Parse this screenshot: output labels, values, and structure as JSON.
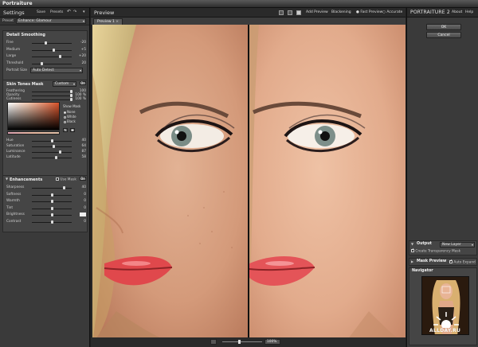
{
  "window": {
    "title": "Portraiture"
  },
  "settings": {
    "title": "Settings",
    "save_label": "Save",
    "presets_label": "Presets",
    "undo_icon": "undo-icon",
    "preset_label": "Preset",
    "preset_value": "Enhance: Glamour",
    "detail_smoothing": {
      "title": "Detail Smoothing",
      "sliders": [
        {
          "label": "Fine",
          "value": "-20",
          "level": 0.35
        },
        {
          "label": "Medium",
          "value": "+5",
          "level": 0.55
        },
        {
          "label": "Large",
          "value": "+20",
          "level": 0.7
        },
        {
          "label": "Threshold",
          "value": "20",
          "level": 0.25
        }
      ],
      "portrait_size_label": "Portrait Size",
      "portrait_size_value": "Auto Detect"
    },
    "skin_tones_mask": {
      "title": "Skin Tones Mask",
      "mode_value": "Custom",
      "toggle": "On",
      "sliders": [
        {
          "label": "Feathering",
          "value": "100",
          "level": 0.98
        },
        {
          "label": "Opacity",
          "value": "100 %",
          "level": 0.98
        },
        {
          "label": "Cutiness",
          "value": "100 %",
          "level": 0.98
        }
      ],
      "show_mask_label": "Show Mask",
      "show_mask_options": [
        "None",
        "White",
        "Black"
      ],
      "show_mask_selected": "None",
      "sliders2": [
        {
          "label": "Hue",
          "value": "40",
          "level": 0.5
        },
        {
          "label": "Saturation",
          "value": "64",
          "level": 0.55
        },
        {
          "label": "Luminance",
          "value": "87",
          "level": 0.7
        },
        {
          "label": "Latitude",
          "value": "58",
          "level": 0.6
        }
      ]
    },
    "enhancements": {
      "title": "Enhancements",
      "use_mask_label": "Use Mask",
      "toggle": "On",
      "sliders": [
        {
          "label": "Sharpness",
          "value": "40",
          "level": 0.8
        },
        {
          "label": "Softness",
          "value": "0",
          "level": 0.5
        },
        {
          "label": "Warmth",
          "value": "0",
          "level": 0.5
        },
        {
          "label": "Tint",
          "value": "0",
          "level": 0.5
        },
        {
          "label": "Brightness",
          "value": "",
          "level": 0.5
        },
        {
          "label": "Contrast",
          "value": "0",
          "level": 0.5
        }
      ]
    }
  },
  "preview": {
    "title": "Preview",
    "add_preview_label": "Add Preview",
    "blackening_label": "Blackening",
    "fast_preview_label": "Fast Preview",
    "accurate_label": "Accurate",
    "tab_label": "Preview 1",
    "zoom_value": "100%"
  },
  "right": {
    "logo": "PORTRAITURE 2",
    "about_label": "About",
    "help_label": "Help",
    "ok_label": "OK",
    "cancel_label": "Cancel",
    "output": {
      "title": "Output",
      "value": "New Layer",
      "checkbox_label": "Create Transparency Mask"
    },
    "mask_preview": {
      "title": "Mask Preview",
      "auto_expand_label": "Auto Expand"
    },
    "navigator": {
      "title": "Navigator"
    }
  },
  "watermark": "ALLDAY.RU",
  "colors": {
    "panel": "#3a3a3a",
    "section": "#454545",
    "header": "#2a2a2a",
    "skin": "#d9a587",
    "lips": "#e0484c"
  }
}
